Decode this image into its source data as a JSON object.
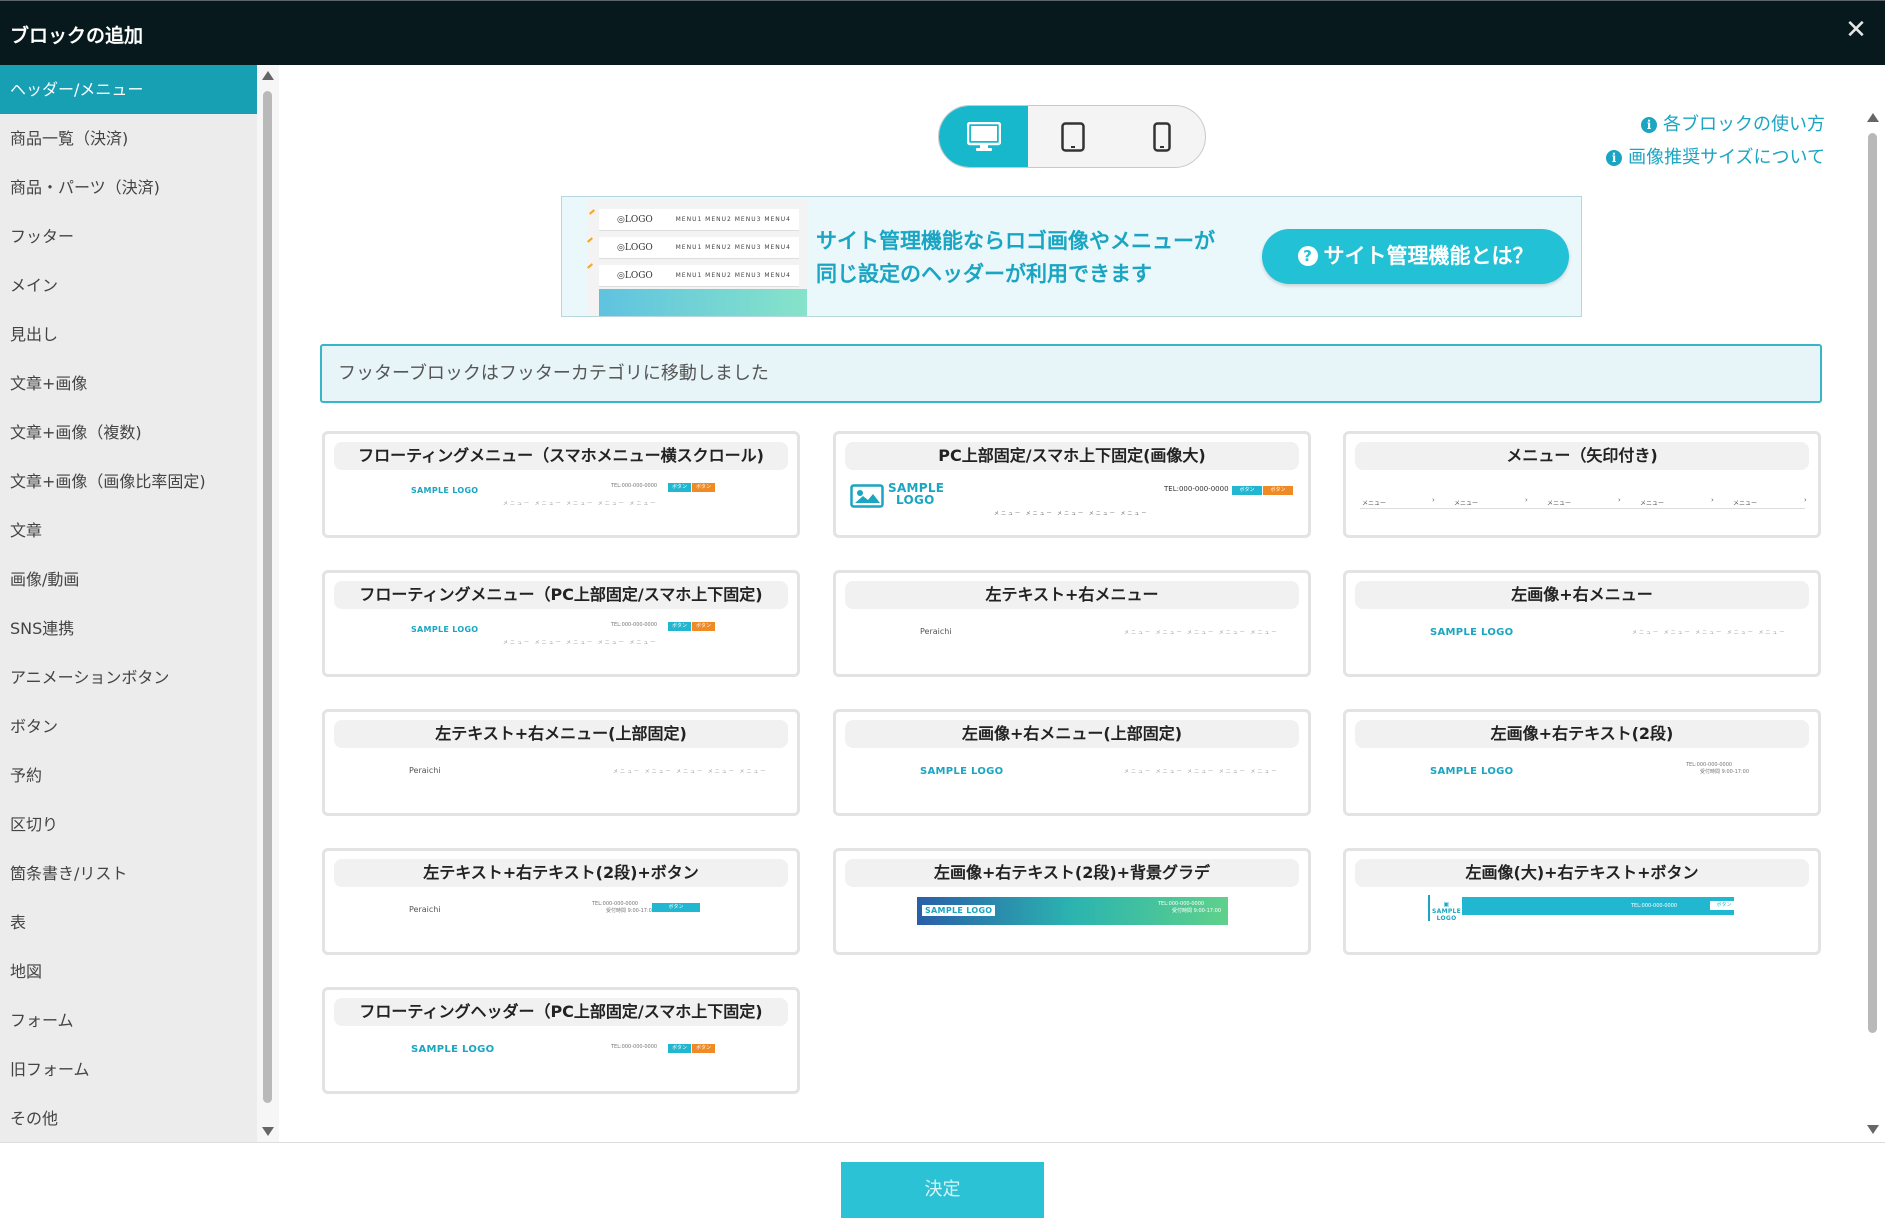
{
  "dialog": {
    "title": "ブロックの追加",
    "close_icon": "close-icon"
  },
  "sidebar": {
    "active_index": 0,
    "items": [
      {
        "label": "ヘッダー/メニュー"
      },
      {
        "label": "商品一覧（決済)"
      },
      {
        "label": "商品・パーツ（決済)"
      },
      {
        "label": "フッター"
      },
      {
        "label": "メイン"
      },
      {
        "label": "見出し"
      },
      {
        "label": "文章+画像"
      },
      {
        "label": "文章+画像（複数)"
      },
      {
        "label": "文章+画像（画像比率固定)"
      },
      {
        "label": "文章"
      },
      {
        "label": "画像/動画"
      },
      {
        "label": "SNS連携"
      },
      {
        "label": "アニメーションボタン"
      },
      {
        "label": "ボタン"
      },
      {
        "label": "予約"
      },
      {
        "label": "区切り"
      },
      {
        "label": "箇条書き/リスト"
      },
      {
        "label": "表"
      },
      {
        "label": "地図"
      },
      {
        "label": "フォーム"
      },
      {
        "label": "旧フォーム"
      },
      {
        "label": "その他"
      }
    ]
  },
  "devices": {
    "active": "desktop",
    "items": [
      {
        "id": "desktop",
        "icon": "desktop-icon"
      },
      {
        "id": "tablet",
        "icon": "tablet-icon"
      },
      {
        "id": "mobile",
        "icon": "mobile-icon"
      }
    ]
  },
  "help": {
    "usage_link": "各ブロックの使い方",
    "image_size_link": "画像推奨サイズについて"
  },
  "banner": {
    "line1": "サイト管理機能ならロゴ画像やメニューが",
    "line2": "同じ設定のヘッダーが利用できます",
    "button": "サイト管理機能とは？",
    "mock_logo": "LOGO",
    "mock_menu": "MENU1 MENU2 MENU3 MENU4"
  },
  "notice": "フッターブロックはフッターカテゴリに移動しました",
  "preview_text": {
    "sample_logo": "SAMPLE LOGO",
    "sample_logo_stacked_1": "SAMPLE",
    "sample_logo_stacked_2": "LOGO",
    "menu_row": "メニュー メニュー メニュー メニュー メニュー",
    "menu_item": "メニュー",
    "tel": "TEL:000-000-0000",
    "hours": "受付時間 9:00-17:00",
    "button_text": "ボタン",
    "peraichi": "Peraichi"
  },
  "cards": [
    {
      "title": "フローティングメニュー（スマホメニュー横スクロール)"
    },
    {
      "title": "PC上部固定/スマホ上下固定(画像大)"
    },
    {
      "title": "メニュー（矢印付き)"
    },
    {
      "title": "フローティングメニュー（PC上部固定/スマホ上下固定)"
    },
    {
      "title": "左テキスト+右メニュー"
    },
    {
      "title": "左画像+右メニュー"
    },
    {
      "title": "左テキスト+右メニュー(上部固定)"
    },
    {
      "title": "左画像+右メニュー(上部固定)"
    },
    {
      "title": "左画像+右テキスト(2段)"
    },
    {
      "title": "左テキスト+右テキスト(2段)+ボタン"
    },
    {
      "title": "左画像+右テキスト(2段)+背景グラデ"
    },
    {
      "title": "左画像(大)+右テキスト+ボタン"
    },
    {
      "title": "フローティングヘッダー（PC上部固定/スマホ上下固定)"
    }
  ],
  "footer": {
    "confirm_button": "決定"
  },
  "colors": {
    "accent": "#17b7cc",
    "titlebar": "#07191d",
    "orange": "#f08a24"
  }
}
